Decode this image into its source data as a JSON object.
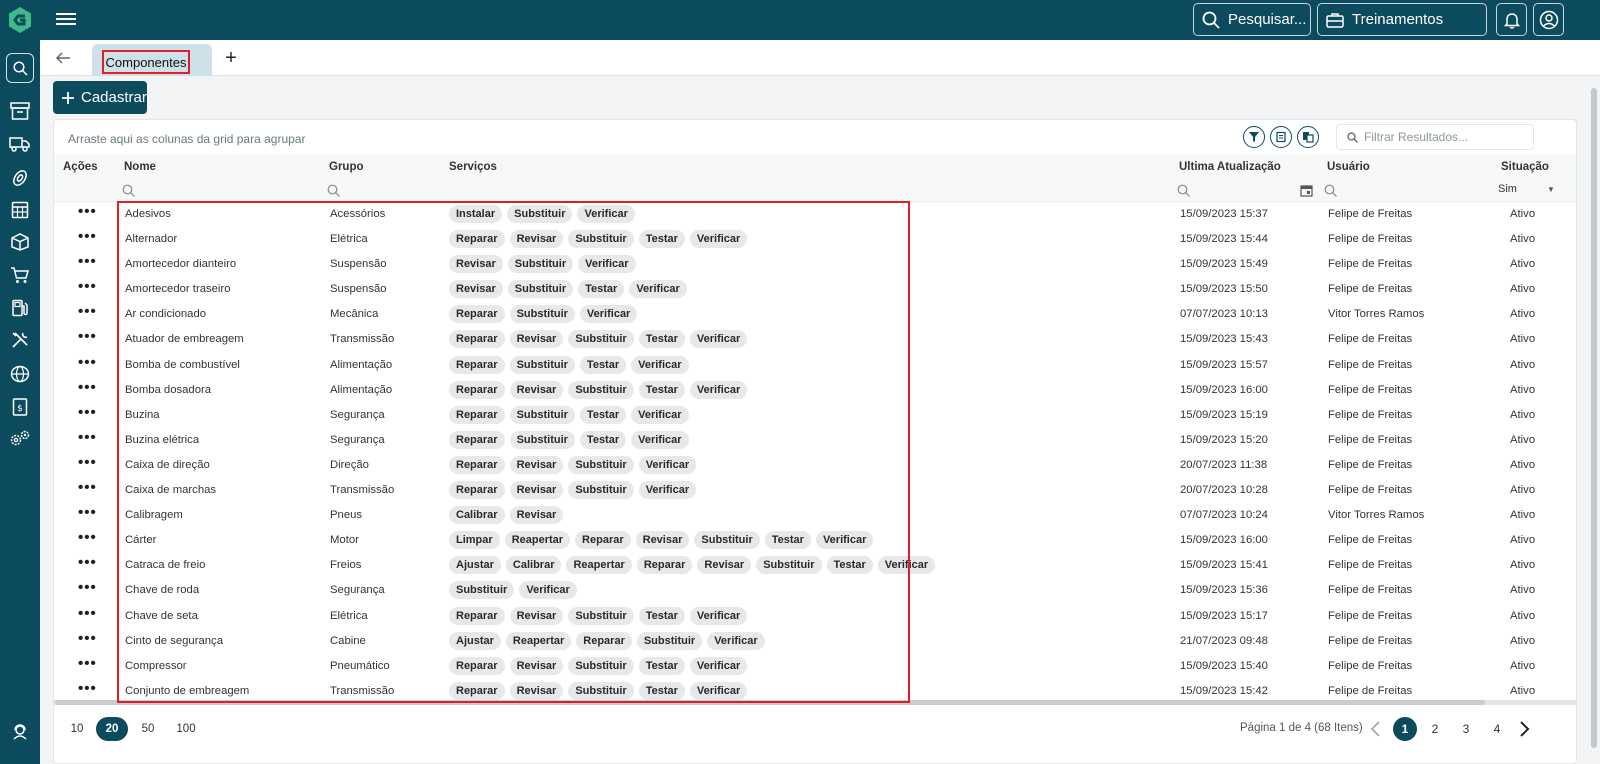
{
  "header": {
    "search_label": "Pesquisar...",
    "training_label": "Treinamentos"
  },
  "tabs": [
    {
      "label": "Componentes"
    }
  ],
  "toolbar": {
    "add_label": "Cadastrar"
  },
  "grid": {
    "group_hint": "Arraste aqui as colunas da grid para agrupar",
    "filter_placeholder": "Filtrar Resultados...",
    "columns": {
      "actions": "Ações",
      "name": "Nome",
      "group": "Grupo",
      "services": "Serviços",
      "updated": "Ultima Atualização",
      "user": "Usuário",
      "status": "Situação"
    },
    "status_filter": "Sim",
    "rows": [
      {
        "name": "Adesivos",
        "group": "Acessórios",
        "services": [
          "Instalar",
          "Substituir",
          "Verificar"
        ],
        "updated": "15/09/2023 15:37",
        "user": "Felipe de Freitas",
        "status": "Ativo"
      },
      {
        "name": "Alternador",
        "group": "Elétrica",
        "services": [
          "Reparar",
          "Revisar",
          "Substituir",
          "Testar",
          "Verificar"
        ],
        "updated": "15/09/2023 15:44",
        "user": "Felipe de Freitas",
        "status": "Ativo"
      },
      {
        "name": "Amortecedor dianteiro",
        "group": "Suspensão",
        "services": [
          "Revisar",
          "Substituir",
          "Verificar"
        ],
        "updated": "15/09/2023 15:49",
        "user": "Felipe de Freitas",
        "status": "Ativo"
      },
      {
        "name": "Amortecedor traseiro",
        "group": "Suspensão",
        "services": [
          "Revisar",
          "Substituir",
          "Testar",
          "Verificar"
        ],
        "updated": "15/09/2023 15:50",
        "user": "Felipe de Freitas",
        "status": "Ativo"
      },
      {
        "name": "Ar condicionado",
        "group": "Mecânica",
        "services": [
          "Reparar",
          "Substituir",
          "Verificar"
        ],
        "updated": "07/07/2023 10:13",
        "user": "Vitor Torres Ramos",
        "status": "Ativo"
      },
      {
        "name": "Atuador de embreagem",
        "group": "Transmissão",
        "services": [
          "Reparar",
          "Revisar",
          "Substituir",
          "Testar",
          "Verificar"
        ],
        "updated": "15/09/2023 15:43",
        "user": "Felipe de Freitas",
        "status": "Ativo"
      },
      {
        "name": "Bomba de combustível",
        "group": "Alimentação",
        "services": [
          "Reparar",
          "Substituir",
          "Testar",
          "Verificar"
        ],
        "updated": "15/09/2023 15:57",
        "user": "Felipe de Freitas",
        "status": "Ativo"
      },
      {
        "name": "Bomba dosadora",
        "group": "Alimentação",
        "services": [
          "Reparar",
          "Revisar",
          "Substituir",
          "Testar",
          "Verificar"
        ],
        "updated": "15/09/2023 16:00",
        "user": "Felipe de Freitas",
        "status": "Ativo"
      },
      {
        "name": "Buzina",
        "group": "Segurança",
        "services": [
          "Reparar",
          "Substituir",
          "Testar",
          "Verificar"
        ],
        "updated": "15/09/2023 15:19",
        "user": "Felipe de Freitas",
        "status": "Ativo"
      },
      {
        "name": "Buzina elétrica",
        "group": "Segurança",
        "services": [
          "Reparar",
          "Substituir",
          "Testar",
          "Verificar"
        ],
        "updated": "15/09/2023 15:20",
        "user": "Felipe de Freitas",
        "status": "Ativo"
      },
      {
        "name": "Caixa de direção",
        "group": "Direção",
        "services": [
          "Reparar",
          "Revisar",
          "Substituir",
          "Verificar"
        ],
        "updated": "20/07/2023 11:38",
        "user": "Felipe de Freitas",
        "status": "Ativo"
      },
      {
        "name": "Caixa de marchas",
        "group": "Transmissão",
        "services": [
          "Reparar",
          "Revisar",
          "Substituir",
          "Verificar"
        ],
        "updated": "20/07/2023 10:28",
        "user": "Felipe de Freitas",
        "status": "Ativo"
      },
      {
        "name": "Calibragem",
        "group": "Pneus",
        "services": [
          "Calibrar",
          "Revisar"
        ],
        "updated": "07/07/2023 10:24",
        "user": "Vitor Torres Ramos",
        "status": "Ativo"
      },
      {
        "name": "Cárter",
        "group": "Motor",
        "services": [
          "Limpar",
          "Reapertar",
          "Reparar",
          "Revisar",
          "Substituir",
          "Testar",
          "Verificar"
        ],
        "updated": "15/09/2023 16:00",
        "user": "Felipe de Freitas",
        "status": "Ativo"
      },
      {
        "name": "Catraca de freio",
        "group": "Freios",
        "services": [
          "Ajustar",
          "Calibrar",
          "Reapertar",
          "Reparar",
          "Revisar",
          "Substituir",
          "Testar",
          "Verificar"
        ],
        "updated": "15/09/2023 15:41",
        "user": "Felipe de Freitas",
        "status": "Ativo"
      },
      {
        "name": "Chave de roda",
        "group": "Segurança",
        "services": [
          "Substituir",
          "Verificar"
        ],
        "updated": "15/09/2023 15:36",
        "user": "Felipe de Freitas",
        "status": "Ativo"
      },
      {
        "name": "Chave de seta",
        "group": "Elétrica",
        "services": [
          "Reparar",
          "Revisar",
          "Substituir",
          "Testar",
          "Verificar"
        ],
        "updated": "15/09/2023 15:17",
        "user": "Felipe de Freitas",
        "status": "Ativo"
      },
      {
        "name": "Cinto de segurança",
        "group": "Cabine",
        "services": [
          "Ajustar",
          "Reapertar",
          "Reparar",
          "Substituir",
          "Verificar"
        ],
        "updated": "21/07/2023 09:48",
        "user": "Felipe de Freitas",
        "status": "Ativo"
      },
      {
        "name": "Compressor",
        "group": "Pneumático",
        "services": [
          "Reparar",
          "Revisar",
          "Substituir",
          "Testar",
          "Verificar"
        ],
        "updated": "15/09/2023 15:40",
        "user": "Felipe de Freitas",
        "status": "Ativo"
      },
      {
        "name": "Conjunto de embreagem",
        "group": "Transmissão",
        "services": [
          "Reparar",
          "Revisar",
          "Substituir",
          "Testar",
          "Verificar"
        ],
        "updated": "15/09/2023 15:42",
        "user": "Felipe de Freitas",
        "status": "Ativo"
      }
    ]
  },
  "pagination": {
    "page_sizes": [
      "10",
      "20",
      "50",
      "100"
    ],
    "active_size": "20",
    "info": "Página 1 de 4 (68 Itens)",
    "pages": [
      "1",
      "2",
      "3",
      "4"
    ],
    "active_page": "1"
  },
  "colors": {
    "primary": "#0c4a5e",
    "highlight": "#e11d2a",
    "chip": "#e6e8ea"
  },
  "icons": [
    "menu-icon",
    "search-icon",
    "briefcase-icon",
    "bell-icon",
    "user-circle-icon",
    "archive-icon",
    "truck-icon",
    "tire-icon",
    "calculator-icon",
    "box-icon",
    "cart-icon",
    "fuel-icon",
    "tools-icon",
    "globe-icon",
    "dollar-doc-icon",
    "settings-icon",
    "support-icon",
    "filter-icon",
    "export-icon",
    "columns-icon",
    "calendar-icon"
  ]
}
